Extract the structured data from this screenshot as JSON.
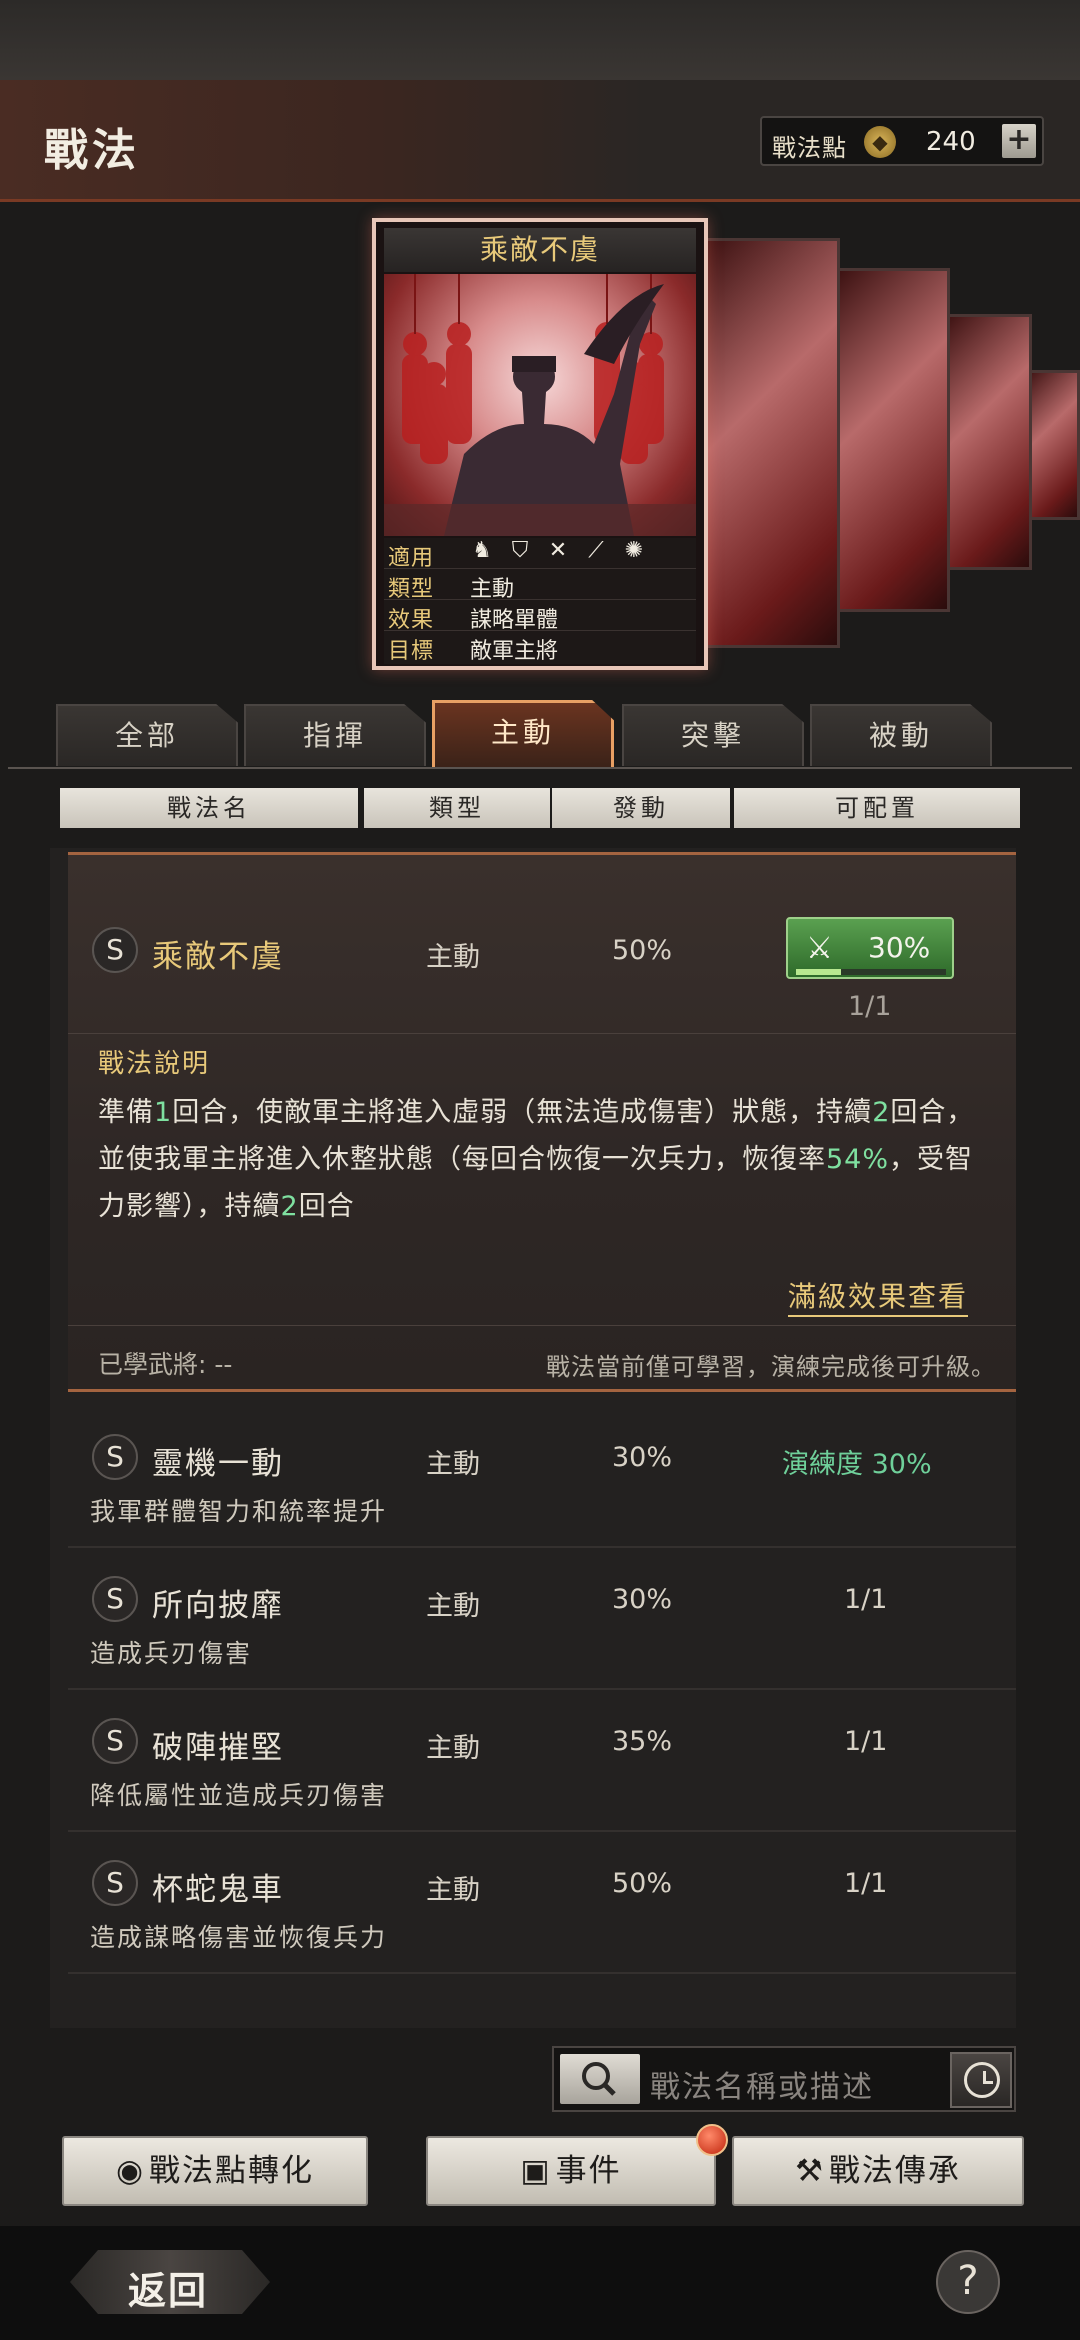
{
  "header": {
    "title": "戰法",
    "points_label": "戰法點",
    "points_value": "240",
    "points_plus": "+"
  },
  "featured_card": {
    "title": "乘敵不虞",
    "rows": [
      {
        "key": "適用",
        "value": ""
      },
      {
        "key": "類型",
        "value": "主動"
      },
      {
        "key": "效果",
        "value": "謀略單體"
      },
      {
        "key": "目標",
        "value": "敵軍主將"
      }
    ],
    "applicable_icons": [
      "cavalry-icon",
      "shield-icon",
      "bow-icon",
      "spear-icon",
      "siege-wheel-icon"
    ]
  },
  "tabs": [
    {
      "label": "全部"
    },
    {
      "label": "指揮"
    },
    {
      "label": "主動"
    },
    {
      "label": "突擊"
    },
    {
      "label": "被動"
    }
  ],
  "active_tab": "主動",
  "columns": [
    "戰法名",
    "類型",
    "發動",
    "可配置"
  ],
  "expanded_skill": {
    "grade": "S",
    "name": "乘敵不虞",
    "type": "主動",
    "rate": "50%",
    "equip_percent": "30%",
    "equip_progress": 0.3,
    "config": "1/1",
    "desc_title": "戰法說明",
    "desc_parts": [
      "準備",
      "1",
      "回合，使敵軍主將進入虛弱（無法造成傷害）狀態，持續",
      "2",
      "回合，並使我軍主將進入休整狀態（每回合恢復一次兵力，恢復率",
      "54%",
      "，受智力影響），持續",
      "2",
      "回合"
    ],
    "max_link": "滿級效果查看",
    "learned": "已學武將: --",
    "upgrade_note": "戰法當前僅可學習，演練完成後可升級。"
  },
  "skills": [
    {
      "grade": "S",
      "name": "靈機一動",
      "type": "主動",
      "rate": "30%",
      "config": "演練度 30%",
      "desc": "我軍群體智力和統率提升"
    },
    {
      "grade": "S",
      "name": "所向披靡",
      "type": "主動",
      "rate": "30%",
      "config": "1/1",
      "desc": "造成兵刃傷害"
    },
    {
      "grade": "S",
      "name": "破陣摧堅",
      "type": "主動",
      "rate": "35%",
      "config": "1/1",
      "desc": "降低屬性並造成兵刃傷害"
    },
    {
      "grade": "S",
      "name": "杯蛇鬼車",
      "type": "主動",
      "rate": "50%",
      "config": "1/1",
      "desc": "造成謀略傷害並恢復兵力"
    }
  ],
  "search": {
    "placeholder": "戰法名稱或描述"
  },
  "buttons": {
    "convert": "戰法點轉化",
    "event": "事件",
    "inherit": "戰法傳承"
  },
  "footer": {
    "back": "返回",
    "help": "?"
  }
}
